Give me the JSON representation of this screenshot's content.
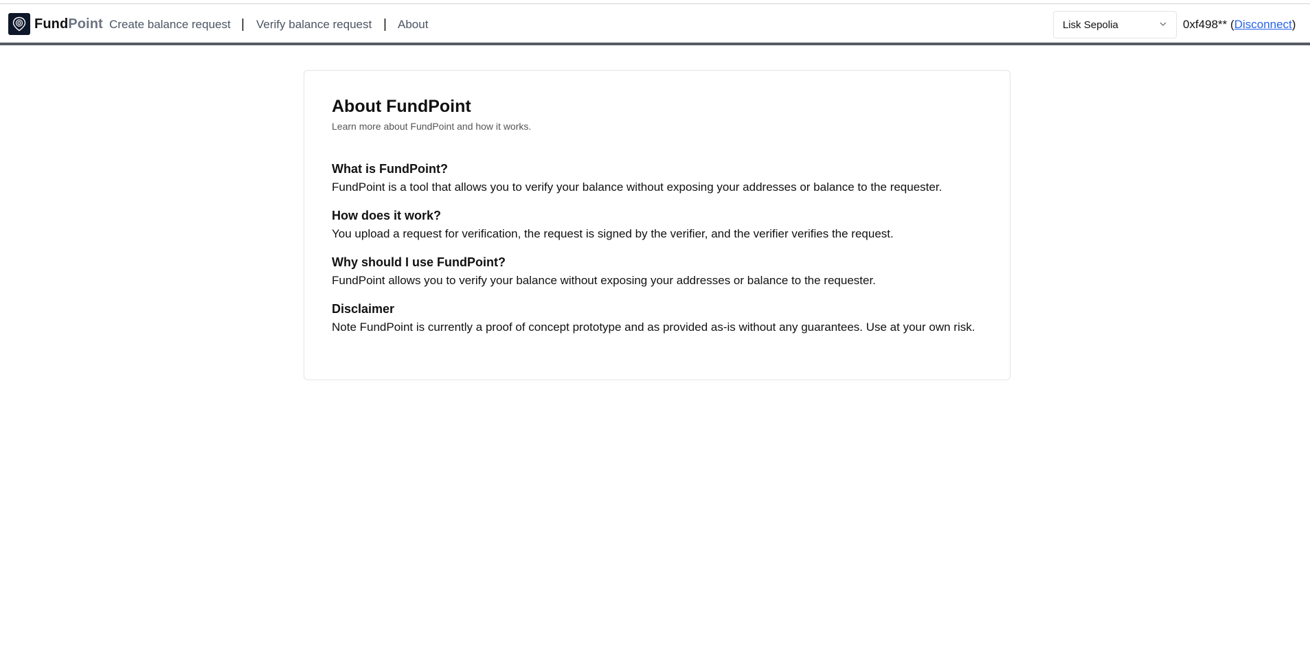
{
  "brand": {
    "name_part1": "Fund",
    "name_part2": "Point",
    "logo_icon": "map-pin-target-icon"
  },
  "nav": {
    "links": [
      {
        "label": "Create balance request"
      },
      {
        "label": "Verify balance request"
      },
      {
        "label": "About"
      }
    ],
    "separator": "|"
  },
  "network_select": {
    "selected": "Lisk Sepolia",
    "icon": "chevron-down-icon"
  },
  "account": {
    "address": "0xf498**",
    "open_paren": "(",
    "disconnect_label": "Disconnect",
    "close_paren": ")"
  },
  "about": {
    "title": "About FundPoint",
    "subtitle": "Learn more about FundPoint and how it works.",
    "sections": [
      {
        "heading": "What is FundPoint?",
        "body": "FundPoint is a tool that allows you to verify your balance without exposing your addresses or balance to the requester."
      },
      {
        "heading": "How does it work?",
        "body": "You upload a request for verification, the request is signed by the verifier, and the verifier verifies the request."
      },
      {
        "heading": "Why should I use FundPoint?",
        "body": "FundPoint allows you to verify your balance without exposing your addresses or balance to the requester."
      },
      {
        "heading": "Disclaimer",
        "body": "Note FundPoint is currently a proof of concept prototype and as provided as-is without any guarantees. Use at your own risk."
      }
    ]
  },
  "colors": {
    "logo_bg": "#0f172a",
    "nav_border": "#555b63",
    "link_blue": "#2563eb",
    "muted_text": "#6b7280"
  }
}
